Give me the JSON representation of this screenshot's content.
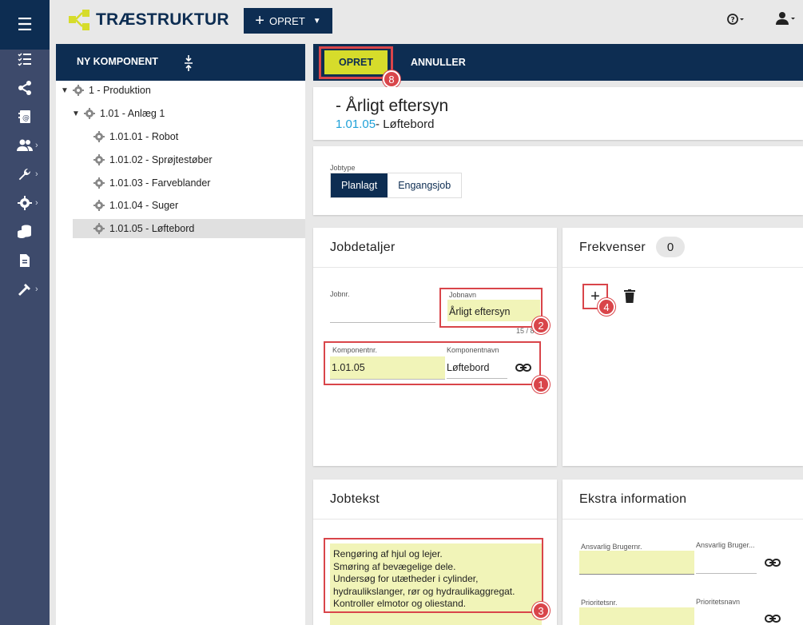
{
  "app": {
    "brand": "TRÆSTRUKTUR",
    "create_label": "OPRET",
    "help_icon": "help-circle-icon",
    "user_icon": "user-icon"
  },
  "sidebar": {
    "icons": [
      "menu-icon",
      "list-check-icon",
      "share-nodes-icon",
      "contacts-icon",
      "users-icon",
      "wrench-icon",
      "gear-icon",
      "database-icon",
      "document-icon",
      "hammer-icon"
    ]
  },
  "tree": {
    "new_component_label": "NY KOMPONENT",
    "nodes": [
      {
        "label": "1 - Produktion",
        "expanded": true
      },
      {
        "label": "1.01 - Anlæg 1",
        "expanded": true
      },
      {
        "label": "1.01.01 - Robot"
      },
      {
        "label": "1.01.02 - Sprøjtestøber"
      },
      {
        "label": "1.01.03 - Farveblander"
      },
      {
        "label": "1.01.04 - Suger"
      },
      {
        "label": "1.01.05 - Løftebord",
        "selected": true
      }
    ]
  },
  "actions": {
    "opret_label": "OPRET",
    "annuller_label": "ANNULLER"
  },
  "header": {
    "title": "- Årligt eftersyn",
    "component_number": "1.01.05",
    "component_name": "- Løftebord"
  },
  "jobtype": {
    "label": "Jobtype",
    "options": [
      "Planlagt",
      "Engangsjob"
    ],
    "selected": "Planlagt"
  },
  "jobdetaljer": {
    "title": "Jobdetaljer",
    "jobnr_label": "Jobnr.",
    "jobnr_value": "",
    "jobnavn_label": "Jobnavn",
    "jobnavn_value": "Årligt eftersyn",
    "jobnavn_counter": "15 / 80",
    "komponentnr_label": "Komponentnr.",
    "komponentnr_value": "1.01.05",
    "komponentnavn_label": "Komponentnavn",
    "komponentnavn_value": "Løftebord"
  },
  "frekvenser": {
    "title": "Frekvenser",
    "count": "0"
  },
  "jobtekst": {
    "title": "Jobtekst",
    "lines": [
      "Rengøring af hjul og lejer.",
      "Smøring af bevægelige dele.",
      "Undersøg for utætheder i cylinder,",
      "hydraulikslanger, rør og hydraulikaggregat.",
      "Kontroller elmotor og oliestand."
    ]
  },
  "ekstra": {
    "title": "Ekstra information",
    "ansvarlig_nr_label": "Ansvarlig Brugernr.",
    "ansvarlig_navn_label": "Ansvarlig Bruger...",
    "prioritet_nr_label": "Prioritetsnr.",
    "prioritet_navn_label": "Prioritetsnavn"
  },
  "annotations": [
    "8",
    "2",
    "1",
    "4",
    "3"
  ],
  "colors": {
    "navy": "#0d2d52",
    "rail": "#3d4a6b",
    "accent_yellow": "#d6dc2b",
    "highlight": "#f1f4b8",
    "link_blue": "#1fa1d8",
    "annotation_red": "#d9454a"
  }
}
